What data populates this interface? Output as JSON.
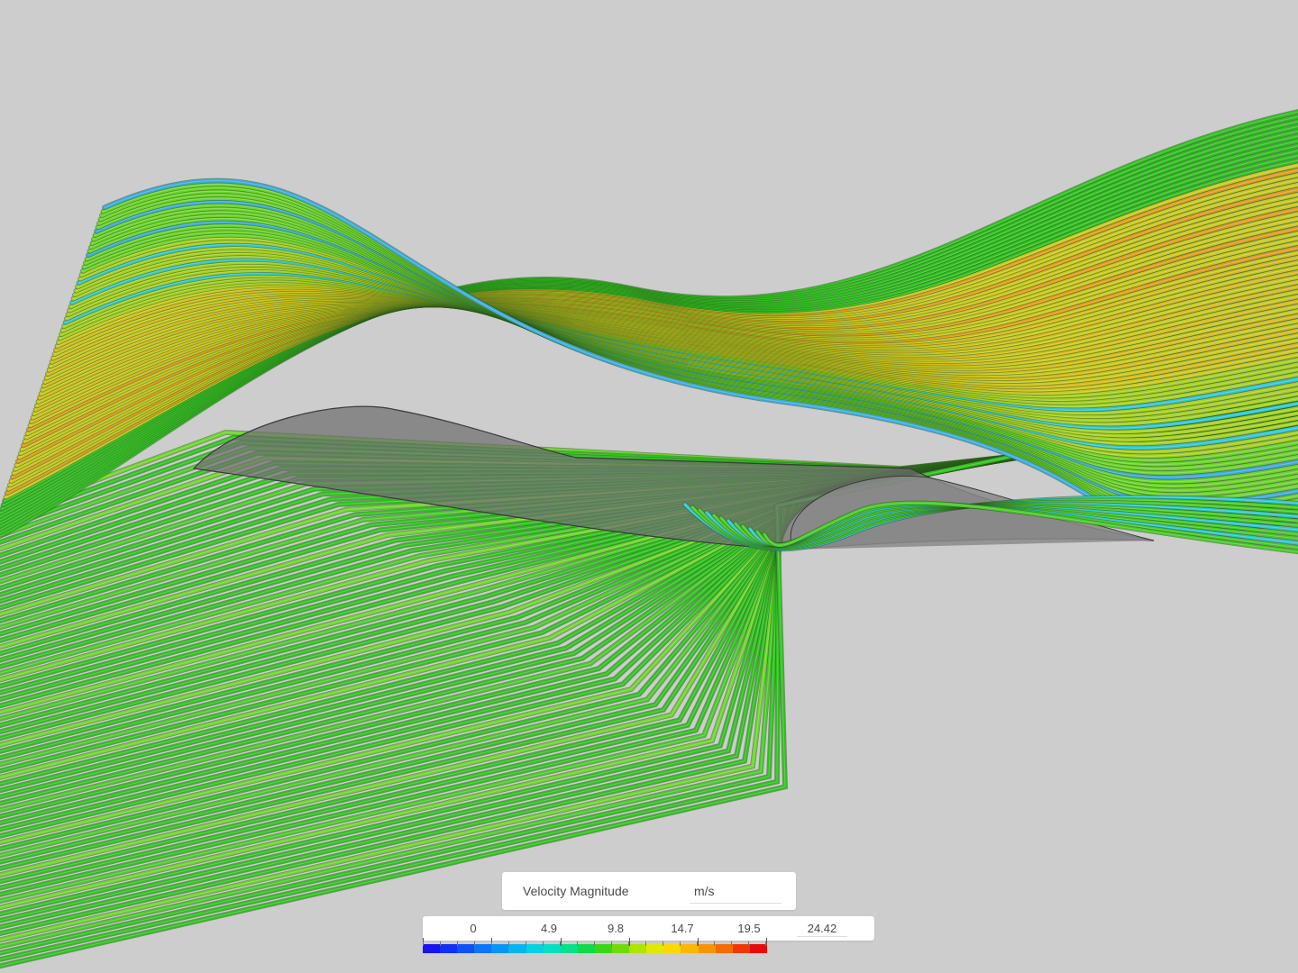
{
  "legend": {
    "title": "Velocity Magnitude",
    "unit": "m/s",
    "ticks": [
      "0",
      "4.9",
      "9.8",
      "14.7",
      "19.5"
    ],
    "max_value": "24.42",
    "colors": [
      "#1a13f0",
      "#1230f5",
      "#1050f7",
      "#0d75f8",
      "#0a95f6",
      "#08b4f0",
      "#06d0e2",
      "#05e0c0",
      "#06e08a",
      "#10d94a",
      "#3ad616",
      "#72da08",
      "#aee400",
      "#e0ea00",
      "#fbd800",
      "#fbb800",
      "#f89400",
      "#f26c00",
      "#ec3a00",
      "#e60c0c"
    ]
  },
  "scene": {
    "background": "#cdcdcd",
    "airfoil_color": "#6f6f6f",
    "stream_colors": [
      "#2fbf1f",
      "#48c928",
      "#6bd42a",
      "#a6cf22",
      "#c9c71d",
      "#d6b81c",
      "#e09a1c",
      "#2ec6d6",
      "#3aa8e0"
    ]
  }
}
